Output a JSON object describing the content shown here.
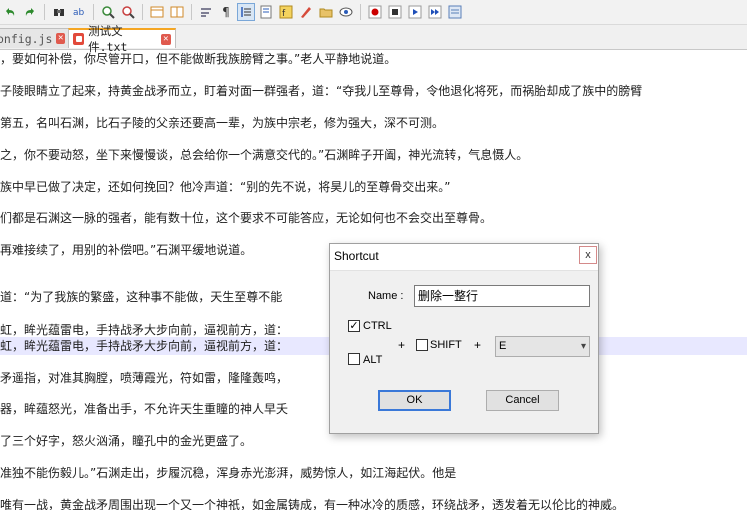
{
  "tabs": {
    "inactive": {
      "label": "onfig.js",
      "close": "✕"
    },
    "active": {
      "label": "测试文件.txt",
      "close": "✕"
    }
  },
  "editor": {
    "lines": [
      "，要如何补偿，你尽管开口，但不能做断我族膀臂之事。”老人平静地说道。",
      "子陵眼睛立了起来，持黄金战矛而立，盯着对面一群强者，道：“夺我儿至尊骨，令他退化将死，而祸胎却成了族中的膀臂",
      "第五，名叫石渊，比石子陵的父亲还要高一辈，为族中宗老，修为强大，深不可测。",
      "之，你不要动怒，坐下来慢慢谈，总会给你一个满意交代的。”石渊眸子开阖，神光流转，气息慑人。",
      "族中早已做了决定，还如何挽回？他冷声道：“别的先不说，将昊儿的至尊骨交出来。”",
      "们都是石渊这一脉的强者，能有数十位，这个要求不可能答应，无论如何也不会交出至尊骨。",
      "再难接续了，用别的补偿吧。”石渊平缓地说道。",
      "",
      "道：“为了我族的繁盛，这种事不能做，天生至尊不能",
      "虹，眸光蕴雷电，手持战矛大步向前，逼视前方，道：",
      "虹，眸光蕴雷电，手持战矛大步向前，逼视前方，道：",
      "矛遥指，对准其胸膛，喷薄霞光，符如雷，隆隆轰鸣，",
      "器，眸蕴怒光，准备出手，不允许天生重瞳的神人早夭",
      "了三个好字，怒火汹涌，瞳孔中的金光更盛了。",
      "准独不能伤毅儿。”石渊走出，步履沉稳，浑身赤光澎湃，威势惊人，如江海起伏。他是",
      "唯有一战，黄金战矛周围出现一个又一个神祇，如金属铸成，有一种冰冷的质感，环绕战矛，透发着无以伦比的神威。"
    ]
  },
  "dialog": {
    "title": "Shortcut",
    "close": "x",
    "name_label": "Name :",
    "name_value": "删除一整行",
    "ctrl_label": "CTRL",
    "ctrl_checked": "✓",
    "alt_label": "ALT",
    "shift_label": "SHIFT",
    "plus1": "+",
    "plus2": "+",
    "key_value": "E",
    "key_arrow": "▾",
    "ok_label": "OK",
    "cancel_label": "Cancel"
  },
  "toolbar": {
    "icons": [
      "undo-icon",
      "redo-icon",
      "find-icon",
      "replace-icon",
      "zoom-in-icon",
      "zoom-out-icon",
      "sync-v-icon",
      "sync-h-icon",
      "wrap-icon",
      "show-all-chars-icon",
      "indent-guide-icon",
      "doc-map-icon",
      "function-list-icon",
      "lang-icon",
      "folder-icon",
      "monitor-icon",
      "record-macro-icon",
      "stop-macro-icon",
      "play-macro-icon",
      "run-multiple-icon",
      "save-macro-icon"
    ],
    "colors": {
      "record": "#cc0000",
      "play": "#1f4fb8",
      "accent": "#f5a623"
    }
  }
}
